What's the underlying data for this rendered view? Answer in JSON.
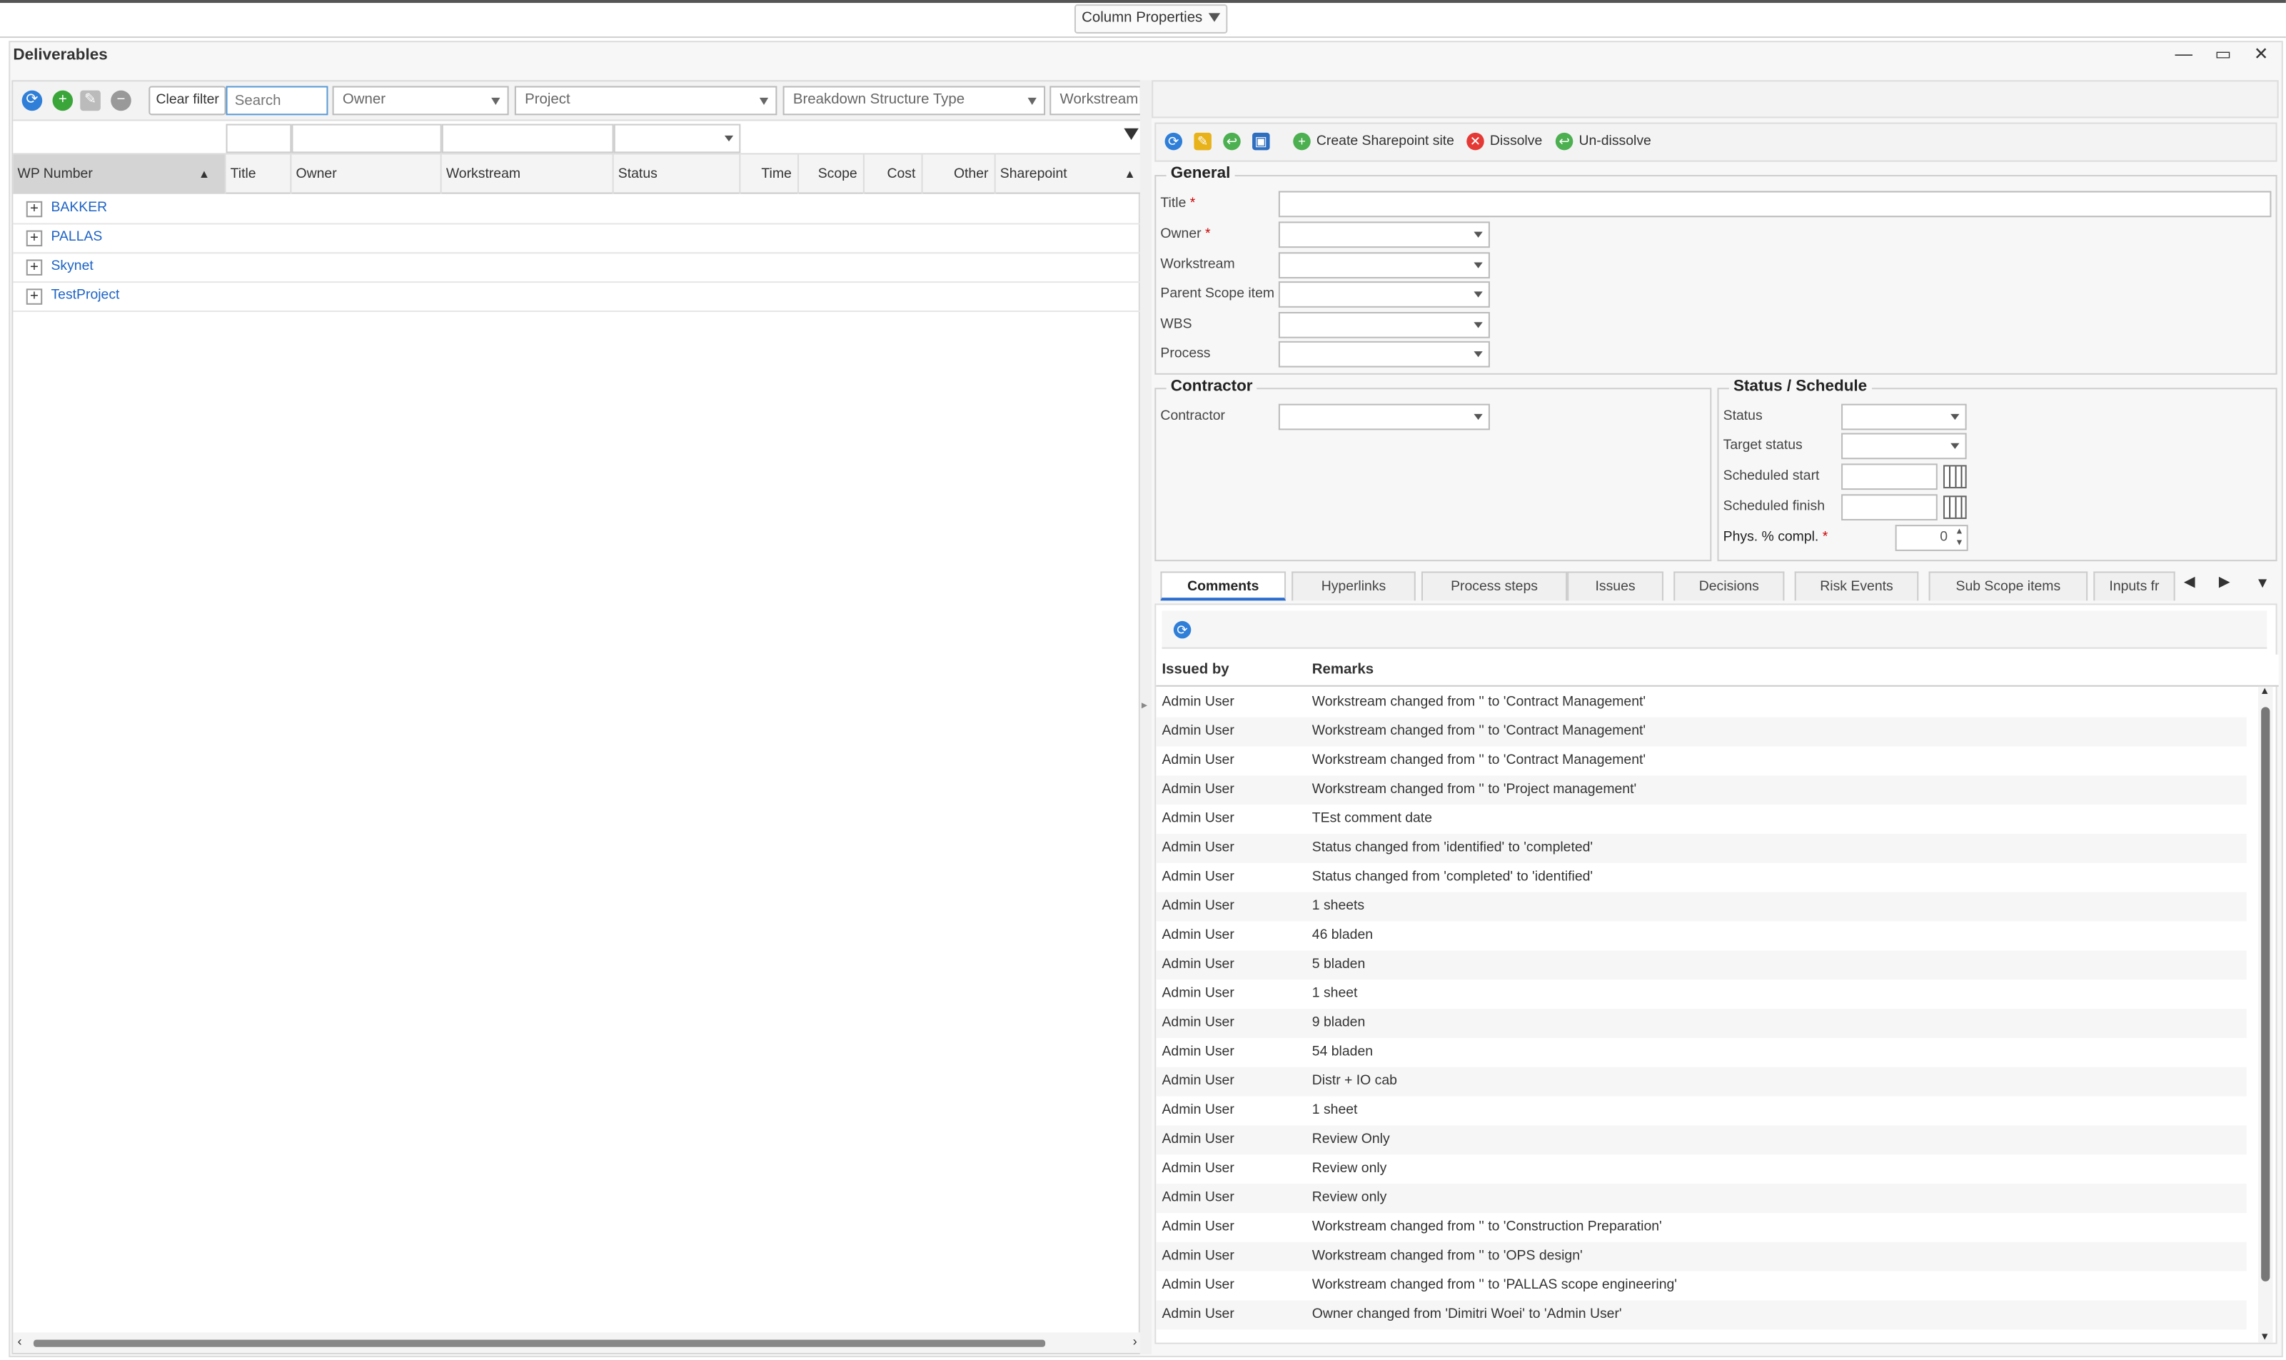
{
  "top": {
    "column_properties_label": "Column Properties"
  },
  "window": {
    "title": "Deliverables",
    "controls": "— ▭ ✕"
  },
  "left": {
    "toolbar": {
      "clear_filter": "Clear filter",
      "search_placeholder": "Search",
      "owner": "Owner",
      "project": "Project",
      "breakdown": "Breakdown Structure Type",
      "workstream": "Workstream"
    },
    "columns": [
      "WP Number",
      "Title",
      "Owner",
      "Workstream",
      "Status",
      "Time",
      "Scope",
      "Cost",
      "Other",
      "Sharepoint"
    ],
    "rows": [
      "BAKKER",
      "PALLAS",
      "Skynet",
      "TestProject"
    ]
  },
  "right": {
    "toolbar": {
      "create": "Create Sharepoint site",
      "dissolve": "Dissolve",
      "undissolve": "Un-dissolve"
    },
    "general": {
      "legend": "General",
      "title": "Title",
      "owner": "Owner",
      "workstream": "Workstream",
      "parent": "Parent Scope item",
      "wbs": "WBS",
      "process": "Process"
    },
    "contractor": {
      "legend": "Contractor",
      "label": "Contractor"
    },
    "status": {
      "legend": "Status / Schedule",
      "status": "Status",
      "target": "Target status",
      "start": "Scheduled start",
      "finish": "Scheduled finish",
      "phys": "Phys. % compl.",
      "phys_value": "0"
    },
    "tabs": [
      "Comments",
      "Hyperlinks",
      "Process steps",
      "Issues",
      "Decisions",
      "Risk Events",
      "Sub Scope items",
      "Inputs fr"
    ],
    "comments": {
      "col_issued": "Issued by",
      "col_remarks": "Remarks",
      "rows": [
        {
          "by": "Admin User",
          "remark": "Workstream changed from '' to 'Contract Management'"
        },
        {
          "by": "Admin User",
          "remark": "Workstream changed from '' to 'Contract Management'"
        },
        {
          "by": "Admin User",
          "remark": "Workstream changed from '' to 'Contract Management'"
        },
        {
          "by": "Admin User",
          "remark": "Workstream changed from '' to 'Project management'"
        },
        {
          "by": "Admin User",
          "remark": "TEst comment date"
        },
        {
          "by": "Admin User",
          "remark": "Status changed from 'identified' to 'completed'"
        },
        {
          "by": "Admin User",
          "remark": "Status changed from 'completed' to 'identified'"
        },
        {
          "by": "Admin User",
          "remark": "1 sheets"
        },
        {
          "by": "Admin User",
          "remark": "46 bladen"
        },
        {
          "by": "Admin User",
          "remark": "5 bladen"
        },
        {
          "by": "Admin User",
          "remark": "1 sheet"
        },
        {
          "by": "Admin User",
          "remark": "9 bladen"
        },
        {
          "by": "Admin User",
          "remark": "54 bladen"
        },
        {
          "by": "Admin User",
          "remark": "Distr + IO cab"
        },
        {
          "by": "Admin User",
          "remark": "1 sheet"
        },
        {
          "by": "Admin User",
          "remark": "Review Only"
        },
        {
          "by": "Admin User",
          "remark": "Review only"
        },
        {
          "by": "Admin User",
          "remark": "Review only"
        },
        {
          "by": "Admin User",
          "remark": "Workstream changed from '' to 'Construction Preparation'"
        },
        {
          "by": "Admin User",
          "remark": "Workstream changed from '' to 'OPS design'"
        },
        {
          "by": "Admin User",
          "remark": "Workstream changed from '' to 'PALLAS scope engineering'"
        },
        {
          "by": "Admin User",
          "remark": "Owner changed from 'Dimitri Woei' to 'Admin User'"
        }
      ]
    }
  }
}
